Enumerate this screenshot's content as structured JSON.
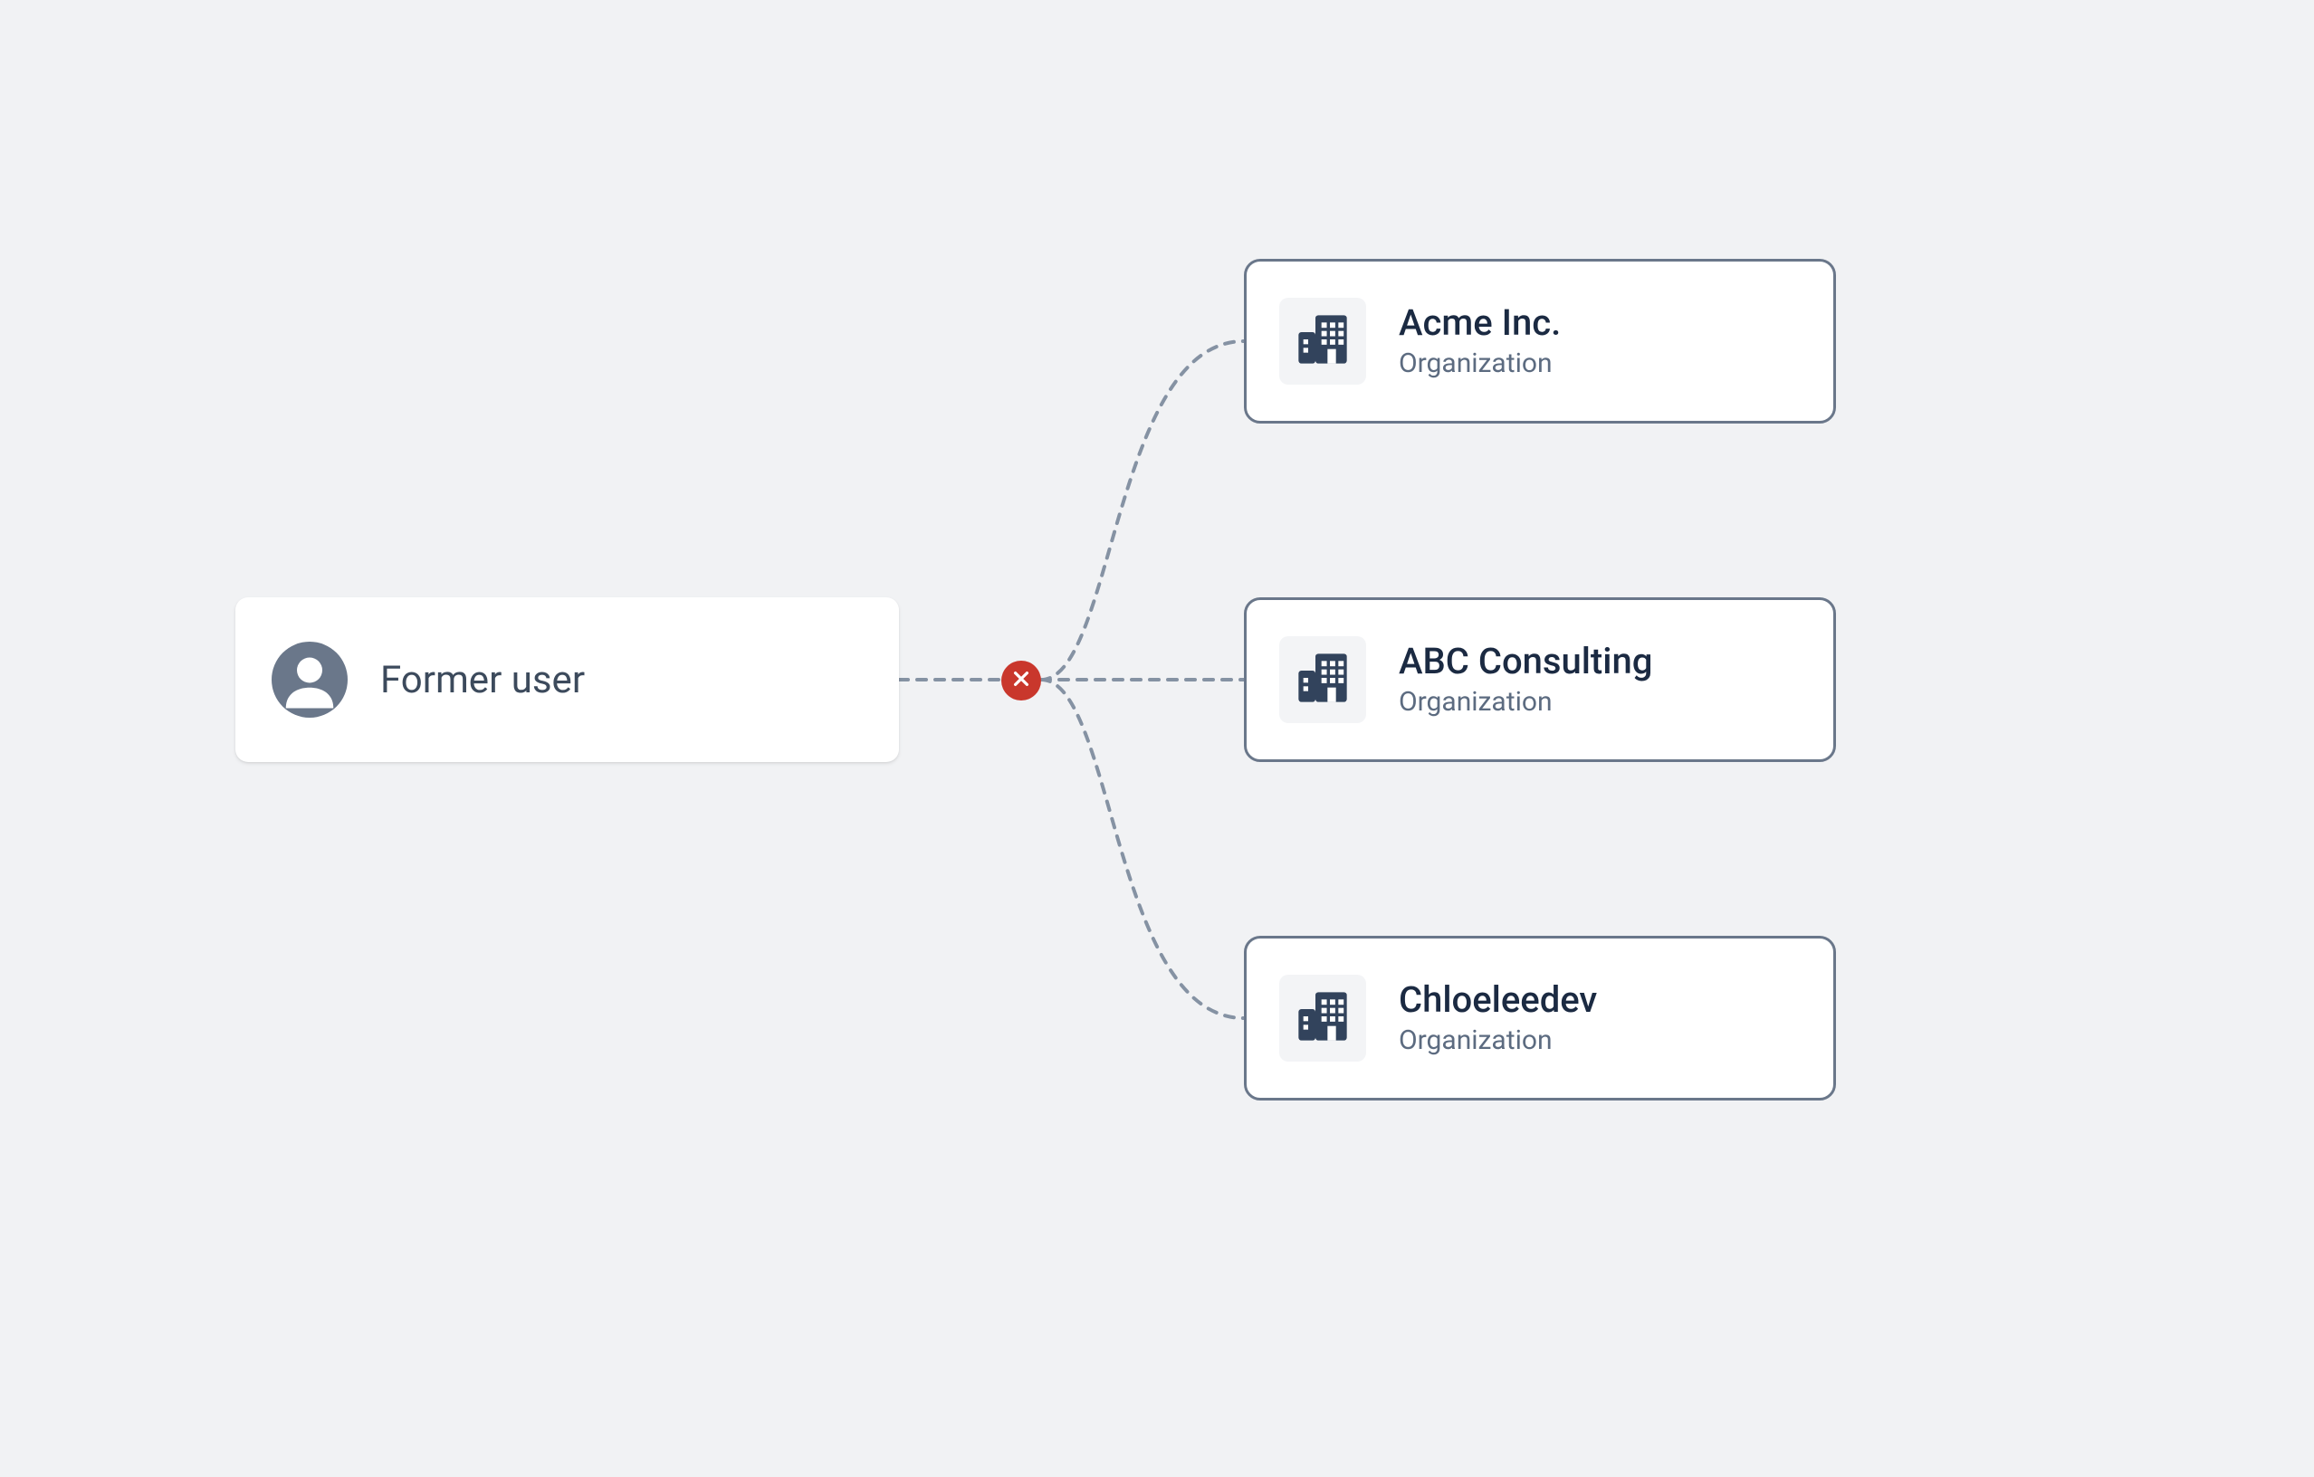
{
  "user": {
    "label": "Former user"
  },
  "organizations": [
    {
      "name": "Acme Inc.",
      "type": "Organization"
    },
    {
      "name": "ABC Consulting",
      "type": "Organization"
    },
    {
      "name": "Chloeleedev",
      "type": "Organization"
    }
  ],
  "colors": {
    "background": "#f1f2f4",
    "card_bg": "#ffffff",
    "org_border": "#6a778a",
    "text_primary": "#1b2a42",
    "text_secondary": "#5c6b80",
    "avatar_fill": "#6a778a",
    "error_badge": "#c9372c",
    "connector": "#8592a3"
  },
  "relationship": {
    "status": "disconnected",
    "icon": "close-icon"
  }
}
